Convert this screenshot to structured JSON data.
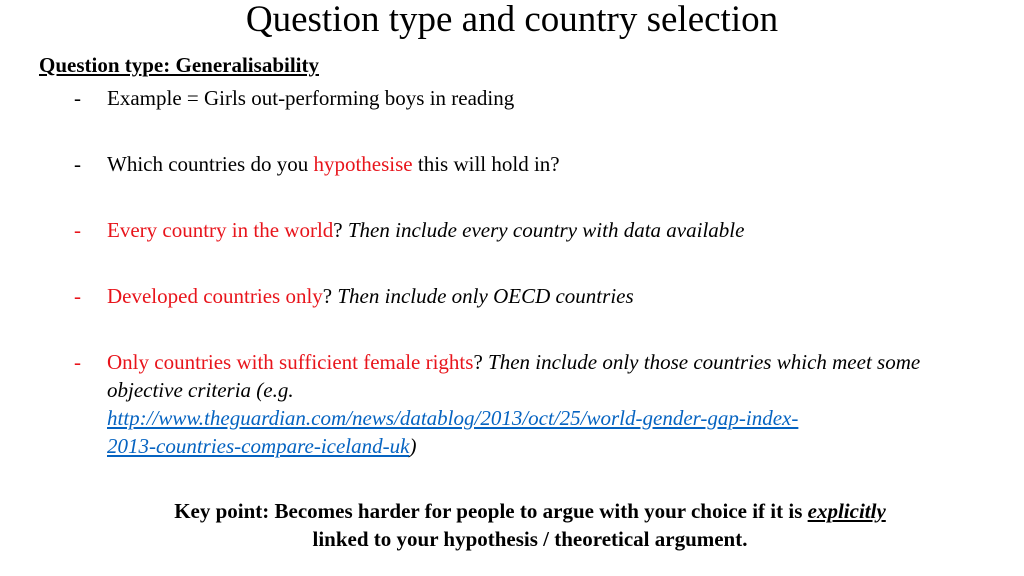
{
  "slide": {
    "title": "Question type and country selection",
    "subtitle": "Question type: Generalisability",
    "bullets": [
      {
        "dash": "-",
        "text": "Example = Girls out-performing boys in reading"
      },
      {
        "dash": "-",
        "before": "Which countries do you ",
        "highlight": "hypothesise",
        "after": " this will hold in?"
      },
      {
        "dash": "-",
        "red": "Every country in the world",
        "q": "?",
        "italic": " Then include every country with data available"
      },
      {
        "dash": "-",
        "red": "Developed countries only",
        "q": "?",
        "italic": " Then include only OECD countries"
      },
      {
        "dash": "-",
        "red": "Only countries with sufficient female rights",
        "q": "?",
        "italic": " Then include only those countries which meet some objective criteria (e.g. ",
        "link": "http://www.theguardian.com/news/datablog/2013/oct/25/world-gender-gap-index-2013-countries-compare-iceland-uk",
        "link_line1": "http://www.theguardian.com/news/datablog/2013/oct/25/world-gender-gap-index-",
        "link_line2": "2013-countries-compare-iceland-uk",
        "close": ")"
      }
    ],
    "key_point": {
      "before": "Key point: Becomes harder for people to argue with your choice if it is ",
      "emphasis": "explicitly",
      "after": "linked to your hypothesis / theoretical argument."
    }
  },
  "colors": {
    "highlight_red": "#e8141b",
    "link_blue": "#0563c1",
    "text": "#000000"
  }
}
